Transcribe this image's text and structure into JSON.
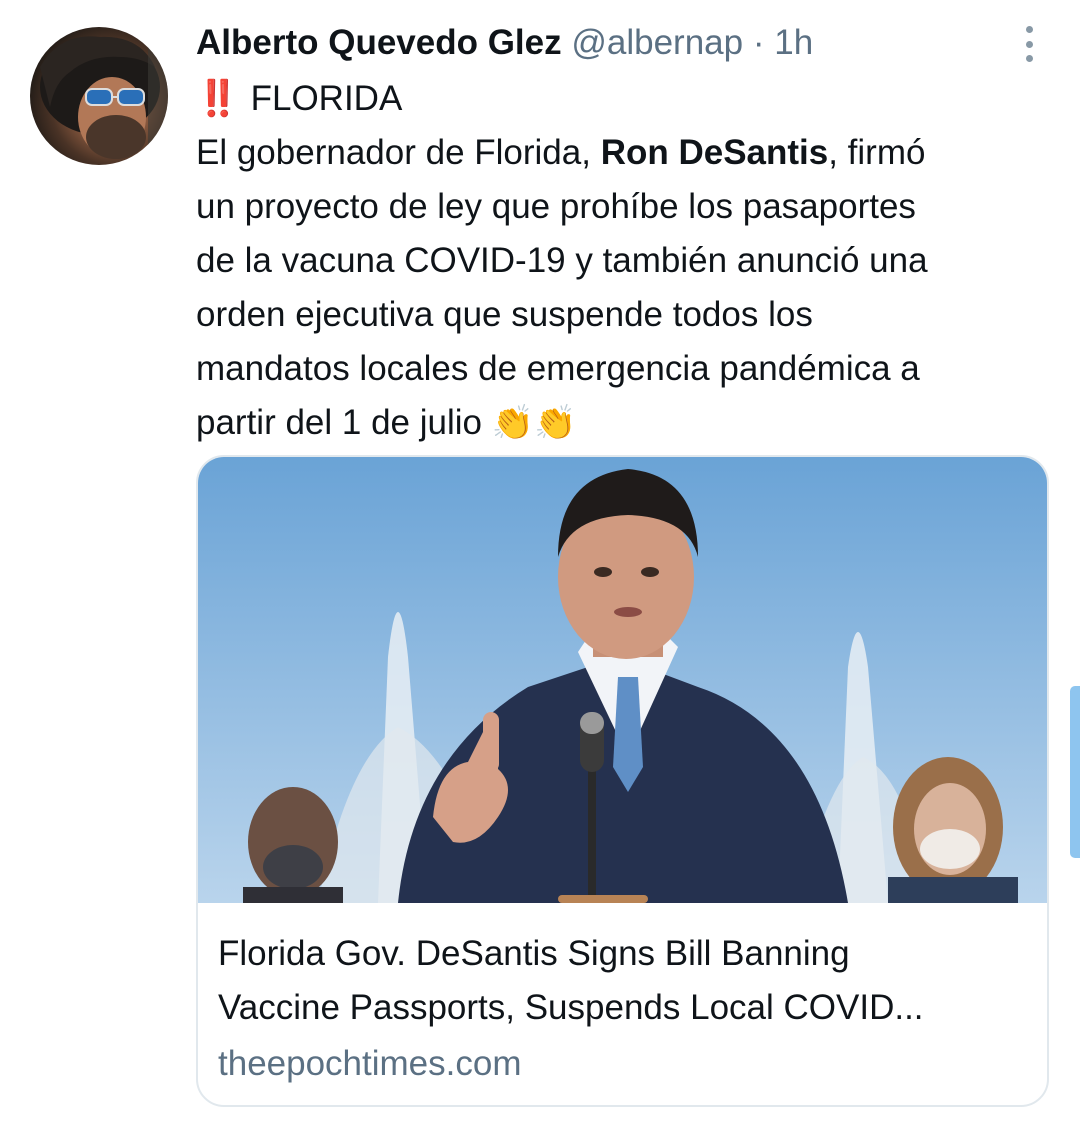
{
  "tweet": {
    "author": {
      "display_name": "Alberto Quevedo Glez",
      "handle": "@albernap",
      "separator": "·",
      "time": "1h"
    },
    "lines": {
      "l1": {
        "emoji": "‼️",
        "text": "FLORIDA"
      },
      "l2": {
        "before": "El gobernador de Florida, ",
        "bold": "Ron DeSantis",
        "after": ", firmó"
      },
      "l3": "un proyecto de ley que prohíbe los pasaportes",
      "l4": "de la vacuna COVID-19 y también anunció una",
      "l5": "orden ejecutiva que suspende todos los",
      "l6": "mandatos locales de emergencia pandémica a",
      "l7": {
        "text": "partir del 1 de julio ",
        "emoji": "👏👏"
      }
    },
    "link_card": {
      "title_line1": "Florida Gov. DeSantis Signs Bill Banning",
      "title_line2": "Vaccine Passports, Suspends Local COVID...",
      "domain": "theepochtimes.com"
    }
  },
  "icons": {
    "more": "more-vertical-icon",
    "alert": "double-exclamation-icon",
    "clap": "clapping-hands-icon"
  },
  "colors": {
    "text": "#0f1419",
    "secondary": "#5b7083",
    "border": "#e1e8ed",
    "accent_scroll": "#8ec5ef",
    "alert_red": "#e0245e"
  }
}
